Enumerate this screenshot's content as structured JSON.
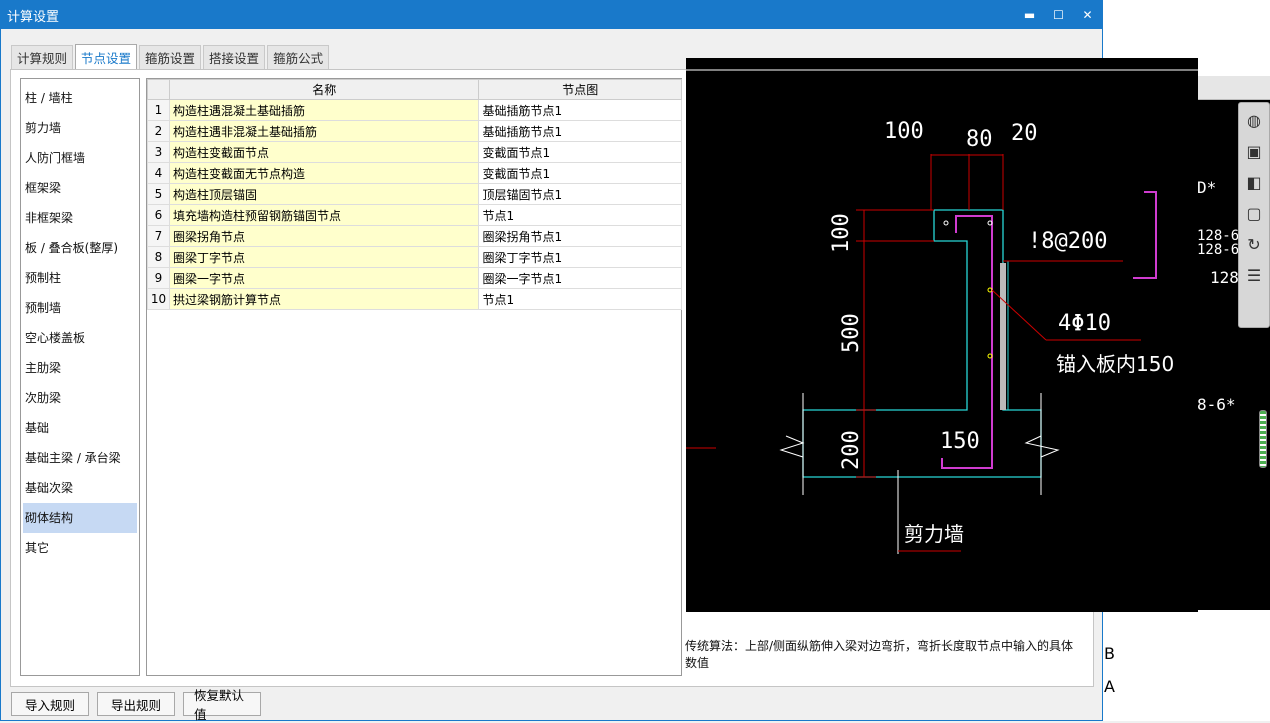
{
  "window": {
    "title": "计算设置",
    "minimize": "▬",
    "maximize": "☐",
    "close": "✕"
  },
  "tabs": [
    {
      "label": "计算规则",
      "active": false
    },
    {
      "label": "节点设置",
      "active": true
    },
    {
      "label": "箍筋设置",
      "active": false
    },
    {
      "label": "搭接设置",
      "active": false
    },
    {
      "label": "箍筋公式",
      "active": false
    }
  ],
  "categories": [
    "柱 / 墙柱",
    "剪力墙",
    "人防门框墙",
    "框架梁",
    "非框架梁",
    "板 / 叠合板(整厚)",
    "预制柱",
    "预制墙",
    "空心楼盖板",
    "主肋梁",
    "次肋梁",
    "基础",
    "基础主梁 / 承台梁",
    "基础次梁",
    "砌体结构",
    "其它"
  ],
  "selected_category": "砌体结构",
  "table": {
    "headers": [
      "名称",
      "节点图"
    ],
    "rows": [
      {
        "idx": "1",
        "name": "构造柱遇混凝土基础插筋",
        "node": "基础插筋节点1"
      },
      {
        "idx": "2",
        "name": "构造柱遇非混凝土基础插筋",
        "node": "基础插筋节点1"
      },
      {
        "idx": "3",
        "name": "构造柱变截面节点",
        "node": "变截面节点1"
      },
      {
        "idx": "4",
        "name": "构造柱变截面无节点构造",
        "node": "变截面节点1"
      },
      {
        "idx": "5",
        "name": "构造柱顶层锚固",
        "node": "顶层锚固节点1"
      },
      {
        "idx": "6",
        "name": "填充墙构造柱预留钢筋锚固节点",
        "node": "节点1"
      },
      {
        "idx": "7",
        "name": "圈梁拐角节点",
        "node": "圈梁拐角节点1"
      },
      {
        "idx": "8",
        "name": "圈梁丁字节点",
        "node": "圈梁丁字节点1"
      },
      {
        "idx": "9",
        "name": "圈梁一字节点",
        "node": "圈梁一字节点1"
      },
      {
        "idx": "10",
        "name": "拱过梁钢筋计算节点",
        "node": "节点1"
      }
    ]
  },
  "diagram": {
    "dim_100_top": "100",
    "dim_80": "80",
    "dim_20": "20",
    "dim_100_left": "100",
    "dim_500": "500",
    "dim_200": "200",
    "dim_150": "150",
    "rebar_spacing": "!8@200",
    "bars": "4Φ10",
    "anchor_note": "锚入板内150",
    "wall_label": "剪力墙"
  },
  "description": "传统算法：上部/侧面纵筋伸入梁对边弯折，弯折长度取节点中输入的具体数值",
  "buttons": {
    "import": "导入规则",
    "export": "导出规则",
    "restore": "恢复默认值"
  },
  "background_cad": {
    "labels": [
      "D*",
      "128-6",
      "128-6",
      "128",
      "8-6*"
    ],
    "letters": [
      "B",
      "A"
    ]
  }
}
